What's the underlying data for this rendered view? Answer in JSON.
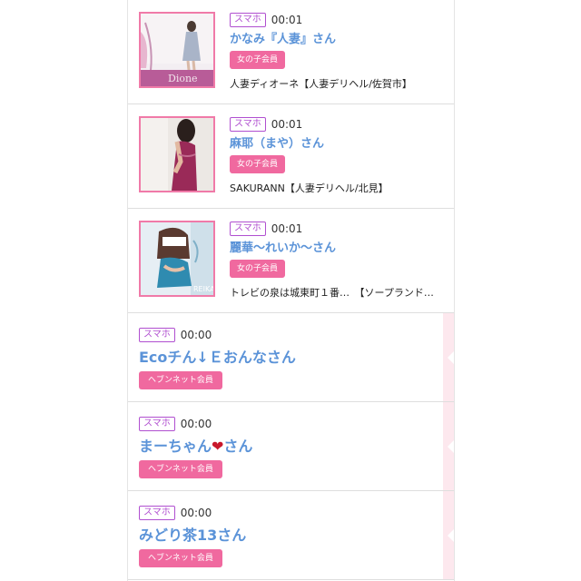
{
  "photo_entries": [
    {
      "device": "スマホ",
      "time": "00:01",
      "name": "かなみ『人妻』さん",
      "badge": "女の子会員",
      "shop": "人妻ディオーネ【人妻デリヘル/佐賀市】",
      "photo_text": "Dione"
    },
    {
      "device": "スマホ",
      "time": "00:01",
      "name": "麻耶（まや）さん",
      "badge": "女の子会員",
      "shop": "SAKURANN【人妻デリヘル/北見】"
    },
    {
      "device": "スマホ",
      "time": "00:01",
      "name": "麗華〜れいか〜さん",
      "badge": "女の子会員",
      "shop": "トレビの泉は城東町１番…　【ソープランド…",
      "photo_text": "REIKA"
    }
  ],
  "text_entries": [
    {
      "device": "スマホ",
      "time": "00:00",
      "name": "Ecoチん↓Ｅおんなさん",
      "badge": "ヘブンネット会員"
    },
    {
      "device": "スマホ",
      "time": "00:00",
      "name_pre": "まーちゃん",
      "name_emoji": "❤",
      "name_post": "さん",
      "badge": "ヘブンネット会員"
    },
    {
      "device": "スマホ",
      "time": "00:00",
      "name": "みどり茶13さん",
      "badge": "ヘブンネット会員"
    }
  ],
  "colors": {
    "badge_pink": "#f0699f",
    "name_blue": "#5b93d8",
    "device_purple": "#b04fd0"
  }
}
